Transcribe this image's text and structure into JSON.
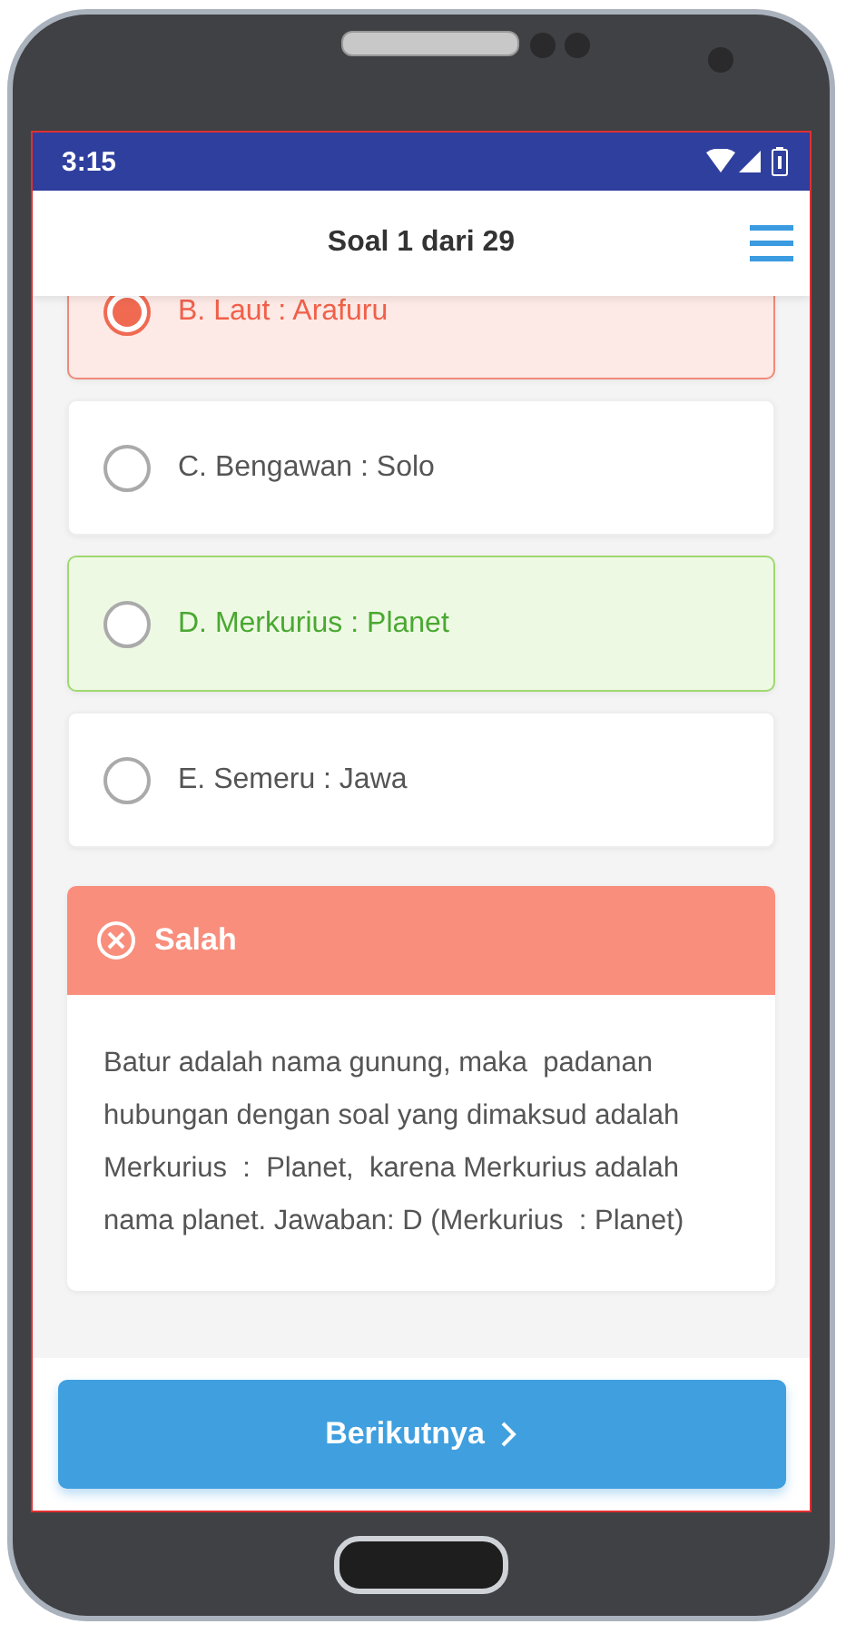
{
  "status_bar": {
    "time": "3:15"
  },
  "header": {
    "title": "Soal 1 dari 29"
  },
  "options": [
    {
      "label": "B. Laut : Arafuru",
      "selected": true,
      "wrong": true,
      "correct": false
    },
    {
      "label": "C. Bengawan : Solo",
      "selected": false,
      "wrong": false,
      "correct": false
    },
    {
      "label": "D. Merkurius : Planet",
      "selected": false,
      "wrong": false,
      "correct": true
    },
    {
      "label": "E. Semeru : Jawa",
      "selected": false,
      "wrong": false,
      "correct": false
    }
  ],
  "feedback": {
    "kind": "wrong",
    "title": "Salah",
    "explanation": "Batur adalah nama gunung, maka  padanan hubungan dengan soal yang dimaksud adalah Merkurius  :  Planet,  karena Merkurius adalah nama planet. Jawaban: D (Merkurius  : Planet)"
  },
  "next_button": {
    "label": "Berikutnya"
  }
}
